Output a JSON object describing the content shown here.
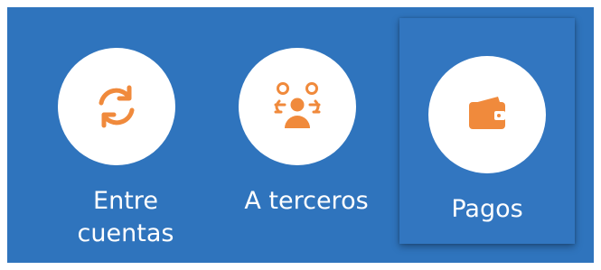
{
  "colors": {
    "panel_background": "#2f74bd",
    "icon_accent": "#f08a3c",
    "circle_background": "#ffffff",
    "label_text": "#ffffff"
  },
  "actions": [
    {
      "id": "between-accounts",
      "icon": "refresh-icon",
      "label": "Entre\ncuentas",
      "selected": false
    },
    {
      "id": "third-parties",
      "icon": "people-group-icon",
      "label": "A terceros",
      "selected": false
    },
    {
      "id": "payments",
      "icon": "wallet-icon",
      "label": "Pagos",
      "selected": true
    }
  ]
}
